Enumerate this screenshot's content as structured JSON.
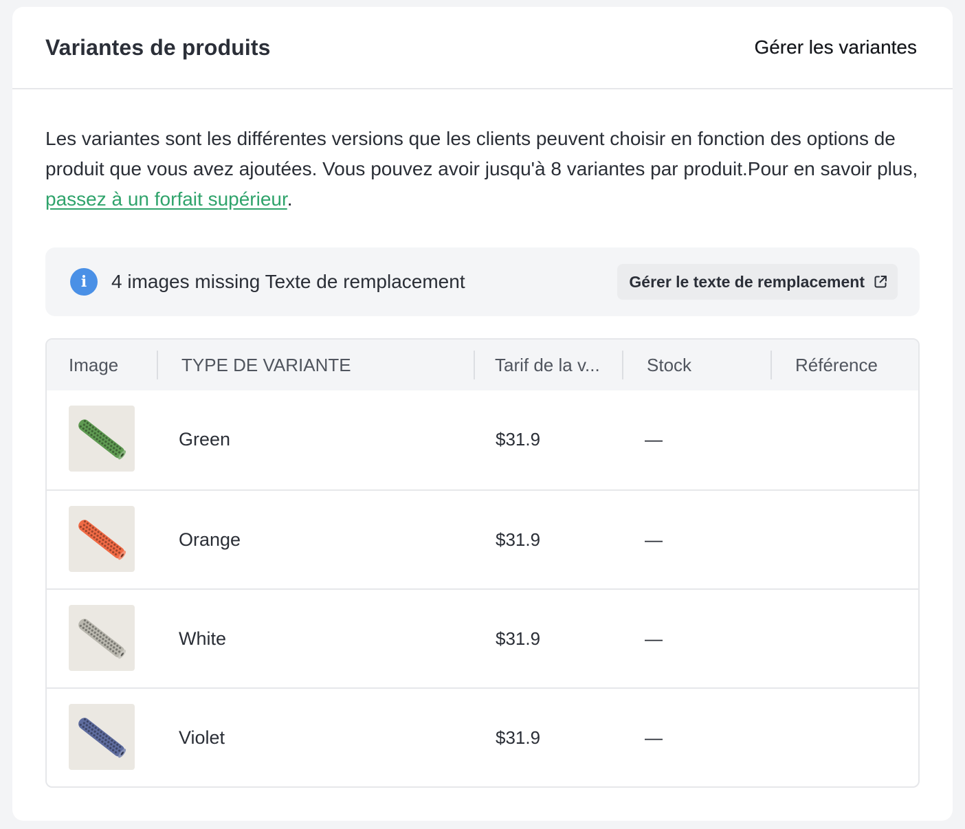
{
  "header": {
    "title": "Variantes de produits",
    "manage_link": "Gérer les variantes"
  },
  "description": {
    "text": "Les variantes sont les différentes versions que les clients peuvent choisir en fonction des options de produit que vous avez ajoutées. Vous pouvez avoir jusqu'à 8 variantes par produit.Pour en savoir plus, ",
    "link": "passez à un forfait supérieur",
    "suffix": "."
  },
  "alert": {
    "icon": "info-icon",
    "icon_glyph": "i",
    "message": "4 images missing Texte de remplacement",
    "button_label": "Gérer le texte de remplacement",
    "button_icon": "external-link-icon"
  },
  "table": {
    "columns": [
      "Image",
      "TYPE DE VARIANTE",
      "Tarif de la v...",
      "Stock",
      "Référence"
    ],
    "rows": [
      {
        "variant": "Green",
        "price": "$31.9",
        "stock": "—",
        "reference": "",
        "color": "#5f9a52"
      },
      {
        "variant": "Orange",
        "price": "$31.9",
        "stock": "—",
        "reference": "",
        "color": "#f06a45"
      },
      {
        "variant": "White",
        "price": "$31.9",
        "stock": "—",
        "reference": "",
        "color": "#b9b7ae"
      },
      {
        "variant": "Violet",
        "price": "$31.9",
        "stock": "—",
        "reference": "",
        "color": "#5e6c9e"
      }
    ]
  },
  "colors": {
    "link": "#2fa36b",
    "info": "#4a90e6"
  }
}
